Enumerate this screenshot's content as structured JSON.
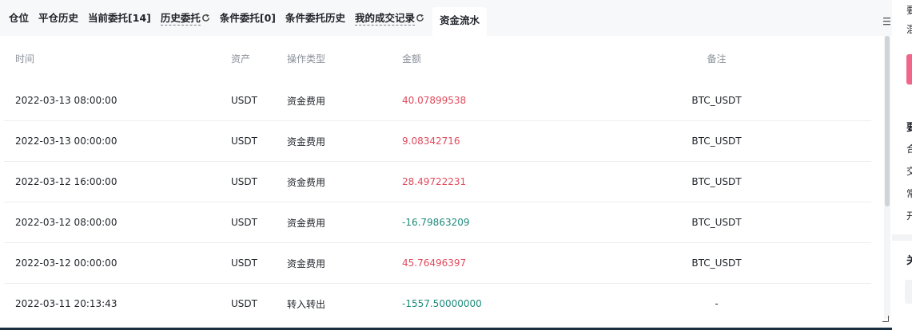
{
  "tabs": [
    {
      "label": "仓位",
      "dashed": false,
      "refresh": false,
      "active": false
    },
    {
      "label": "平仓历史",
      "dashed": false,
      "refresh": false,
      "active": false
    },
    {
      "label": "当前委托[14]",
      "dashed": false,
      "refresh": false,
      "active": false
    },
    {
      "label": "历史委托",
      "dashed": true,
      "refresh": true,
      "active": false
    },
    {
      "label": "条件委托[0]",
      "dashed": false,
      "refresh": false,
      "active": false
    },
    {
      "label": "条件委托历史",
      "dashed": false,
      "refresh": false,
      "active": false
    },
    {
      "label": "我的成交记录",
      "dashed": true,
      "refresh": true,
      "active": false
    },
    {
      "label": "资金流水",
      "dashed": false,
      "refresh": false,
      "active": true
    }
  ],
  "table": {
    "headers": {
      "time": "时间",
      "asset": "资产",
      "type": "操作类型",
      "amount": "金额",
      "note": "备注"
    },
    "rows": [
      {
        "time": "2022-03-13 08:00:00",
        "asset": "USDT",
        "type": "资金费用",
        "amount": "40.07899538",
        "note": "BTC_USDT"
      },
      {
        "time": "2022-03-13 00:00:00",
        "asset": "USDT",
        "type": "资金费用",
        "amount": "9.08342716",
        "note": "BTC_USDT"
      },
      {
        "time": "2022-03-12 16:00:00",
        "asset": "USDT",
        "type": "资金费用",
        "amount": "28.49722231",
        "note": "BTC_USDT"
      },
      {
        "time": "2022-03-12 08:00:00",
        "asset": "USDT",
        "type": "资金费用",
        "amount": "-16.79863209",
        "note": "BTC_USDT"
      },
      {
        "time": "2022-03-12 00:00:00",
        "asset": "USDT",
        "type": "资金费用",
        "amount": "45.76496397",
        "note": "BTC_USDT"
      },
      {
        "time": "2022-03-11 20:13:43",
        "asset": "USDT",
        "type": "转入转出",
        "amount": "-1557.50000000",
        "note": "-"
      }
    ]
  },
  "side": {
    "top_chars": [
      "要",
      "混"
    ],
    "section_chars": [
      {
        "text": "要",
        "bold": true
      },
      {
        "text": "合",
        "bold": false
      },
      {
        "text": "交",
        "bold": false
      },
      {
        "text": "常",
        "bold": false
      },
      {
        "text": "开",
        "bold": false
      }
    ],
    "bottom_char": "关"
  },
  "colors": {
    "positive": "#e04a5c",
    "negative": "#1d8a7a",
    "accent_button": "#f0668a"
  },
  "icons": {
    "refresh": "refresh-icon",
    "menu": "menu-icon",
    "resize": "resize-icon"
  }
}
